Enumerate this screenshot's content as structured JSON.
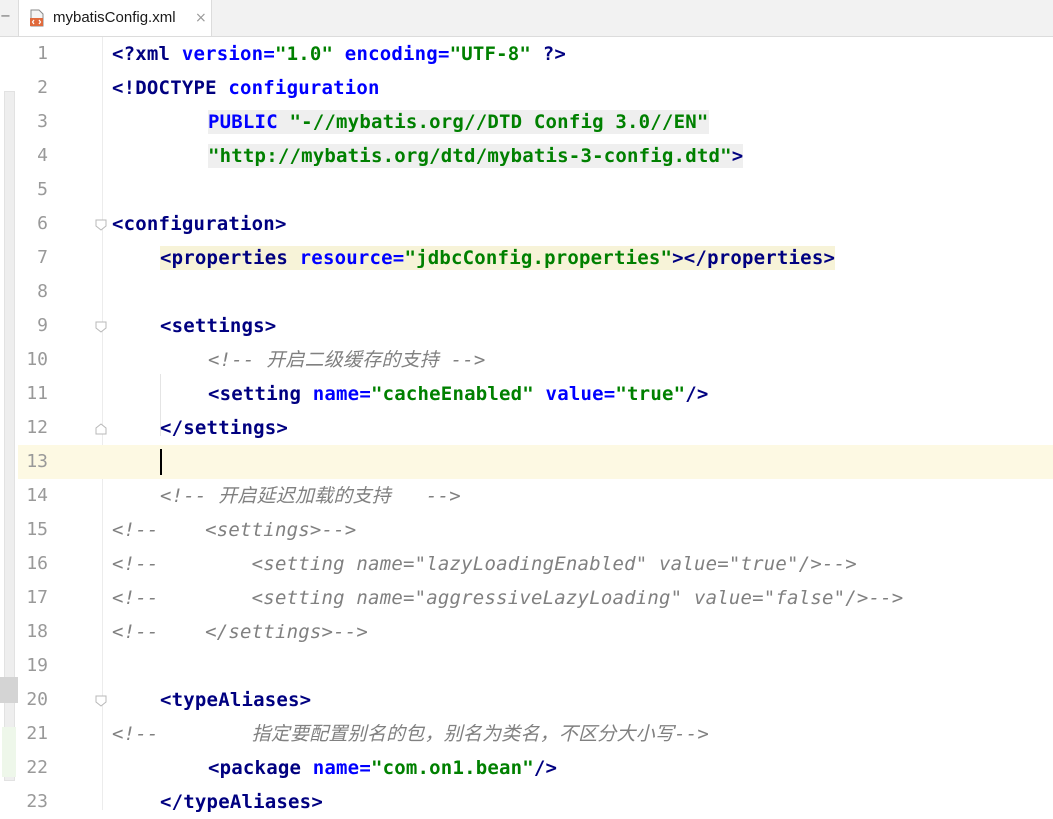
{
  "tab": {
    "file_name": "mybatisConfig.xml",
    "close_symbol": "×",
    "minus_symbol": "−"
  },
  "editor": {
    "current_line": "13",
    "lines": [
      {
        "n": "1"
      },
      {
        "n": "2"
      },
      {
        "n": "3"
      },
      {
        "n": "4"
      },
      {
        "n": "5"
      },
      {
        "n": "6"
      },
      {
        "n": "7"
      },
      {
        "n": "8"
      },
      {
        "n": "9"
      },
      {
        "n": "10"
      },
      {
        "n": "11"
      },
      {
        "n": "12"
      },
      {
        "n": "13"
      },
      {
        "n": "14"
      },
      {
        "n": "15"
      },
      {
        "n": "16"
      },
      {
        "n": "17"
      },
      {
        "n": "18"
      },
      {
        "n": "19"
      },
      {
        "n": "20"
      },
      {
        "n": "21"
      },
      {
        "n": "22"
      },
      {
        "n": "23"
      }
    ],
    "code": {
      "l1": [
        "<?",
        "xml ",
        "version",
        "=",
        "\"1.0\"",
        " encoding",
        "=",
        "\"UTF-8\"",
        " ?>"
      ],
      "l2": [
        "<!DOCTYPE ",
        "configuration"
      ],
      "l3": [
        "PUBLIC ",
        "\"-//mybatis.org//DTD Config 3.0//EN\""
      ],
      "l4": [
        "\"http://mybatis.org/dtd/mybatis-3-config.dtd\"",
        ">"
      ],
      "l6": [
        "<",
        "configuration",
        ">"
      ],
      "l7": [
        "<",
        "properties",
        " resource",
        "=",
        "\"jdbcConfig.properties\"",
        "></",
        "properties",
        ">"
      ],
      "l9": [
        "<",
        "settings",
        ">"
      ],
      "l10": "<!-- 开启二级缓存的支持 -->",
      "l11": [
        "<",
        "setting",
        " name",
        "=",
        "\"cacheEnabled\"",
        " value",
        "=",
        "\"true\"",
        "/>"
      ],
      "l12": [
        "</",
        "settings",
        ">"
      ],
      "l14": "<!-- 开启延迟加载的支持   -->",
      "l15": "<!--    <settings>-->",
      "l16": "<!--        <setting name=\"lazyLoadingEnabled\" value=\"true\"/>-->",
      "l17": "<!--        <setting name=\"aggressiveLazyLoading\" value=\"false\"/>-->",
      "l18": "<!--    </settings>-->",
      "l20": [
        "<",
        "typeAliases",
        ">"
      ],
      "l21": "<!--        指定要配置别名的包，别名为类名，不区分大小写-->",
      "l22": [
        "<",
        "package",
        " name",
        "=",
        "\"com.on1.bean\"",
        "/>"
      ],
      "l23": [
        "</",
        "typeAliases",
        ">"
      ]
    }
  },
  "icons": {
    "file": "xml-file-icon",
    "fold": "fold-marker-icon"
  },
  "colors": {
    "tag": "#000080",
    "attribute": "#0000ff",
    "string": "#008000",
    "comment": "#808080",
    "current_line_bg": "#fdf9e3"
  }
}
